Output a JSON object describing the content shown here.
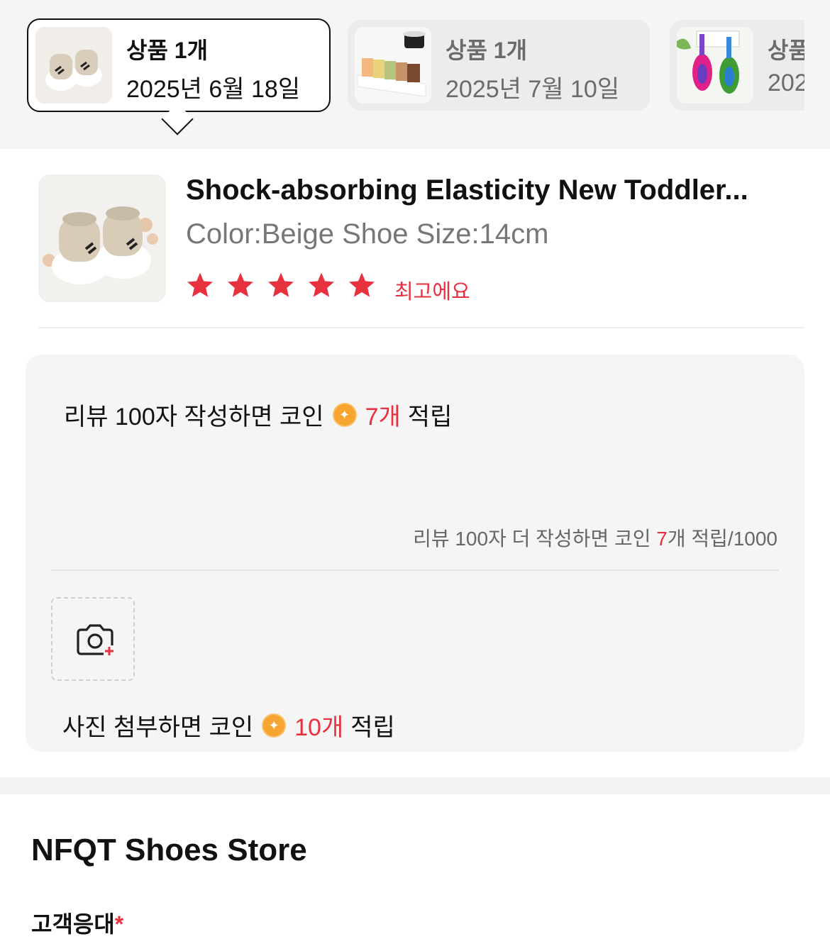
{
  "orders": [
    {
      "count": "상품 1개",
      "date": "2025년 6월 18일",
      "selected": true,
      "thumb_icon": "baby-shoes-image"
    },
    {
      "count": "상품 1개",
      "date": "2025년 7월 10일",
      "selected": false,
      "thumb_icon": "cake-slices-image"
    },
    {
      "count": "상품",
      "date": "202",
      "selected": false,
      "thumb_icon": "toothbrush-image"
    }
  ],
  "product": {
    "title": "Shock-absorbing Elasticity New Toddler...",
    "variant": "Color:Beige Shoe Size:14cm",
    "stars": 5,
    "rating_label": "최고에요",
    "star_color": "#e8313e"
  },
  "review": {
    "hint_prefix": "리뷰 100자 작성하면 코인",
    "hint_amount": "7개",
    "hint_suffix": "적립",
    "counter_prefix": "리뷰 100자 더 작성하면 코인 ",
    "counter_amount": "7",
    "counter_suffix": "개 적립/1000",
    "photo_hint_prefix": "사진 첨부하면 코인",
    "photo_hint_amount": "10개",
    "photo_hint_suffix": "적립"
  },
  "store": {
    "name": "NFQT Shoes Store",
    "cs_label": "고객응대",
    "required_mark": "*"
  }
}
